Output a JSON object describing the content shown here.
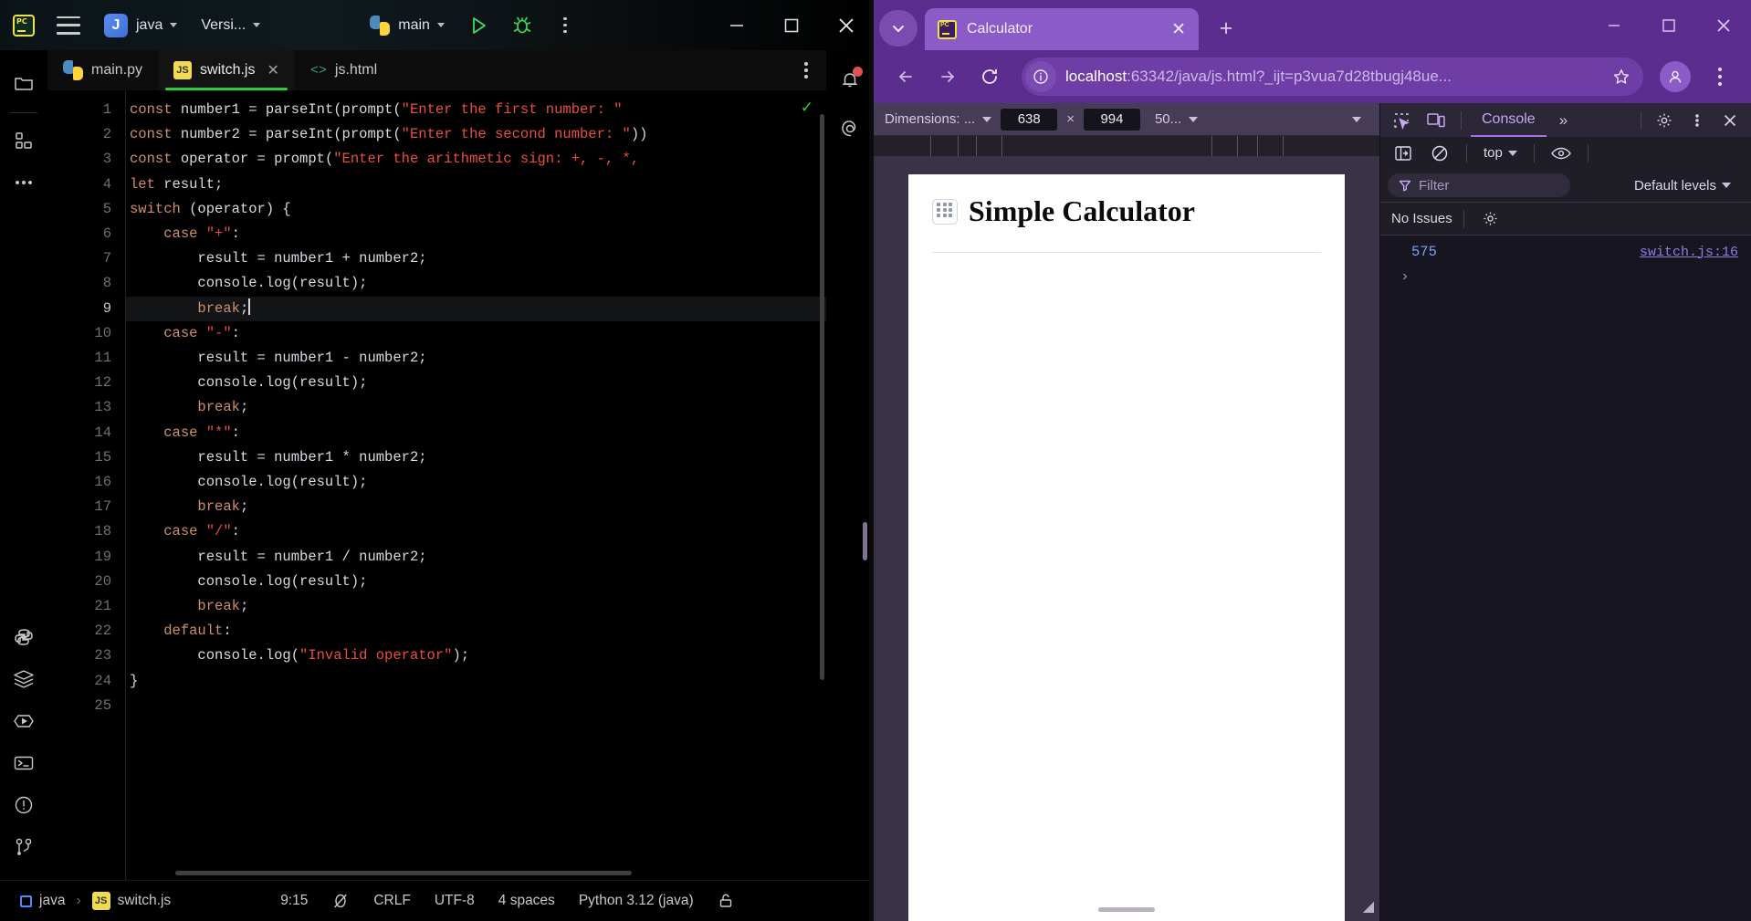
{
  "ide": {
    "titlebar": {
      "logo": "pycharm-logo",
      "menu_icon": "main-menu-icon",
      "project_badge": "J",
      "project_name": "java",
      "vcs_label": "Versi...",
      "run_config": "main",
      "run_icon": "run-icon",
      "debug_icon": "debug-icon",
      "more_icon": "more-actions-icon"
    },
    "tabs": [
      {
        "label": "main.py",
        "icon": "python-file-icon",
        "active": false,
        "closable": false
      },
      {
        "label": "switch.js",
        "icon": "javascript-file-icon",
        "active": true,
        "closable": true
      },
      {
        "label": "js.html",
        "icon": "html-file-icon",
        "active": false,
        "closable": false
      }
    ],
    "activity_bar": [
      "project-folder-icon",
      "structure-icon",
      "more-tool-windows-icon",
      "python-console-icon",
      "database-icon",
      "run-widget-icon",
      "terminal-icon",
      "problems-icon",
      "version-control-icon"
    ],
    "right_bar": [
      "notifications-bell-icon",
      "ai-assistant-icon"
    ],
    "notification_badge": true,
    "editor": {
      "language": "javascript",
      "current_line": 9,
      "line_count": 25,
      "lines": [
        {
          "n": 1,
          "tokens": [
            {
              "t": "kw",
              "s": "const"
            },
            {
              "t": "fn",
              "s": " number1 = parseInt(prompt("
            },
            {
              "t": "str",
              "s": "\"Enter the first number: \""
            }
          ]
        },
        {
          "n": 2,
          "tokens": [
            {
              "t": "kw",
              "s": "const"
            },
            {
              "t": "fn",
              "s": " number2 = parseInt(prompt("
            },
            {
              "t": "str",
              "s": "\"Enter the second number: \""
            },
            {
              "t": "fn",
              "s": "))"
            }
          ]
        },
        {
          "n": 3,
          "tokens": [
            {
              "t": "kw",
              "s": "const"
            },
            {
              "t": "fn",
              "s": " operator = prompt("
            },
            {
              "t": "str",
              "s": "\"Enter the arithmetic sign: +, -, *,"
            }
          ]
        },
        {
          "n": 4,
          "tokens": [
            {
              "t": "kw",
              "s": "let"
            },
            {
              "t": "fn",
              "s": " result;"
            }
          ]
        },
        {
          "n": 5,
          "tokens": [
            {
              "t": "kw",
              "s": "switch"
            },
            {
              "t": "fn",
              "s": " (operator) {"
            }
          ]
        },
        {
          "n": 6,
          "tokens": [
            {
              "t": "fn",
              "s": "    "
            },
            {
              "t": "kw",
              "s": "case"
            },
            {
              "t": "fn",
              "s": " "
            },
            {
              "t": "str",
              "s": "\"+\""
            },
            {
              "t": "fn",
              "s": ":"
            }
          ]
        },
        {
          "n": 7,
          "tokens": [
            {
              "t": "fn",
              "s": "        result = number1 + number2;"
            }
          ]
        },
        {
          "n": 8,
          "tokens": [
            {
              "t": "fn",
              "s": "        console.log(result);"
            }
          ]
        },
        {
          "n": 9,
          "tokens": [
            {
              "t": "fn",
              "s": "        "
            },
            {
              "t": "kw",
              "s": "break"
            },
            {
              "t": "fn",
              "s": ";"
            }
          ],
          "caret": true
        },
        {
          "n": 10,
          "tokens": [
            {
              "t": "fn",
              "s": "    "
            },
            {
              "t": "kw",
              "s": "case"
            },
            {
              "t": "fn",
              "s": " "
            },
            {
              "t": "str",
              "s": "\"-\""
            },
            {
              "t": "fn",
              "s": ":"
            }
          ]
        },
        {
          "n": 11,
          "tokens": [
            {
              "t": "fn",
              "s": "        result = number1 - number2;"
            }
          ]
        },
        {
          "n": 12,
          "tokens": [
            {
              "t": "fn",
              "s": "        console.log(result);"
            }
          ]
        },
        {
          "n": 13,
          "tokens": [
            {
              "t": "fn",
              "s": "        "
            },
            {
              "t": "kw",
              "s": "break"
            },
            {
              "t": "fn",
              "s": ";"
            }
          ]
        },
        {
          "n": 14,
          "tokens": [
            {
              "t": "fn",
              "s": "    "
            },
            {
              "t": "kw",
              "s": "case"
            },
            {
              "t": "fn",
              "s": " "
            },
            {
              "t": "str",
              "s": "\"*\""
            },
            {
              "t": "fn",
              "s": ":"
            }
          ]
        },
        {
          "n": 15,
          "tokens": [
            {
              "t": "fn",
              "s": "        result = number1 * number2;"
            }
          ]
        },
        {
          "n": 16,
          "tokens": [
            {
              "t": "fn",
              "s": "        console.log(result);"
            }
          ]
        },
        {
          "n": 17,
          "tokens": [
            {
              "t": "fn",
              "s": "        "
            },
            {
              "t": "kw",
              "s": "break"
            },
            {
              "t": "fn",
              "s": ";"
            }
          ]
        },
        {
          "n": 18,
          "tokens": [
            {
              "t": "fn",
              "s": "    "
            },
            {
              "t": "kw",
              "s": "case"
            },
            {
              "t": "fn",
              "s": " "
            },
            {
              "t": "str",
              "s": "\"/\""
            },
            {
              "t": "fn",
              "s": ":"
            }
          ]
        },
        {
          "n": 19,
          "tokens": [
            {
              "t": "fn",
              "s": "        result = number1 / number2;"
            }
          ]
        },
        {
          "n": 20,
          "tokens": [
            {
              "t": "fn",
              "s": "        console.log(result);"
            }
          ]
        },
        {
          "n": 21,
          "tokens": [
            {
              "t": "fn",
              "s": "        "
            },
            {
              "t": "kw",
              "s": "break"
            },
            {
              "t": "fn",
              "s": ";"
            }
          ]
        },
        {
          "n": 22,
          "tokens": [
            {
              "t": "fn",
              "s": "    "
            },
            {
              "t": "kw",
              "s": "default"
            },
            {
              "t": "fn",
              "s": ":"
            }
          ]
        },
        {
          "n": 23,
          "tokens": [
            {
              "t": "fn",
              "s": "        console.log("
            },
            {
              "t": "str",
              "s": "\"Invalid operator\""
            },
            {
              "t": "fn",
              "s": ");"
            }
          ]
        },
        {
          "n": 24,
          "tokens": [
            {
              "t": "fn",
              "s": "}"
            }
          ]
        },
        {
          "n": 25,
          "tokens": [
            {
              "t": "fn",
              "s": ""
            }
          ]
        }
      ]
    },
    "statusbar": {
      "breadcrumb_project": "java",
      "breadcrumb_sep": "›",
      "breadcrumb_file": "switch.js",
      "caret_position": "9:15",
      "no_read_only_icon": "inspections-off-icon",
      "line_separator": "CRLF",
      "encoding": "UTF-8",
      "indent": "4 spaces",
      "interpreter": "Python 3.12 (java)",
      "lock_icon": "unlocked-icon"
    }
  },
  "browser": {
    "tab_list_icon": "tab-search-icon",
    "tab": {
      "title": "Calculator",
      "favicon": "pycharm-favicon",
      "close_icon": "close-icon"
    },
    "new_tab_icon": "+",
    "window_controls": [
      "minimize-icon",
      "maximize-icon",
      "close-icon"
    ],
    "nav": {
      "back_icon": "back-arrow-icon",
      "forward_icon": "forward-arrow-icon",
      "reload_icon": "reload-icon",
      "site_info_icon": "site-info-icon",
      "url_host": "localhost",
      "url_rest": ":63342/java/js.html?_ijt=p3vua7d28tbugj48ue...",
      "bookmark_icon": "star-icon",
      "profile_icon": "profile-avatar-icon",
      "menu_icon": "browser-menu-icon"
    }
  },
  "devtools": {
    "device_toolbar": {
      "dimensions_label": "Dimensions: ...",
      "width": "638",
      "x_symbol": "×",
      "height": "994",
      "zoom": "50...",
      "more_icon": "device-more-options-icon"
    },
    "page": {
      "title": "Simple Calculator",
      "favicon": "calculator-icon"
    },
    "tabbar": {
      "inspect_icon": "inspect-element-icon",
      "device_toggle_icon": "device-toolbar-icon",
      "active_tab": "Console",
      "more_tabs": "»",
      "settings_icon": "settings-gear-icon",
      "kebab_icon": "devtools-more-icon",
      "close_icon": "close-devtools-icon"
    },
    "toolbar": {
      "sidebar_icon": "console-sidebar-icon",
      "clear_icon": "clear-console-icon",
      "context": "top",
      "eye_icon": "live-expression-icon"
    },
    "filterbar": {
      "filter_icon": "filter-icon",
      "filter_placeholder": "Filter",
      "levels_label": "Default levels"
    },
    "issues": {
      "text": "No Issues",
      "settings_icon": "issues-settings-icon"
    },
    "console_rows": [
      {
        "value": "575",
        "source": "switch.js:16"
      }
    ],
    "prompt_symbol": "›"
  }
}
